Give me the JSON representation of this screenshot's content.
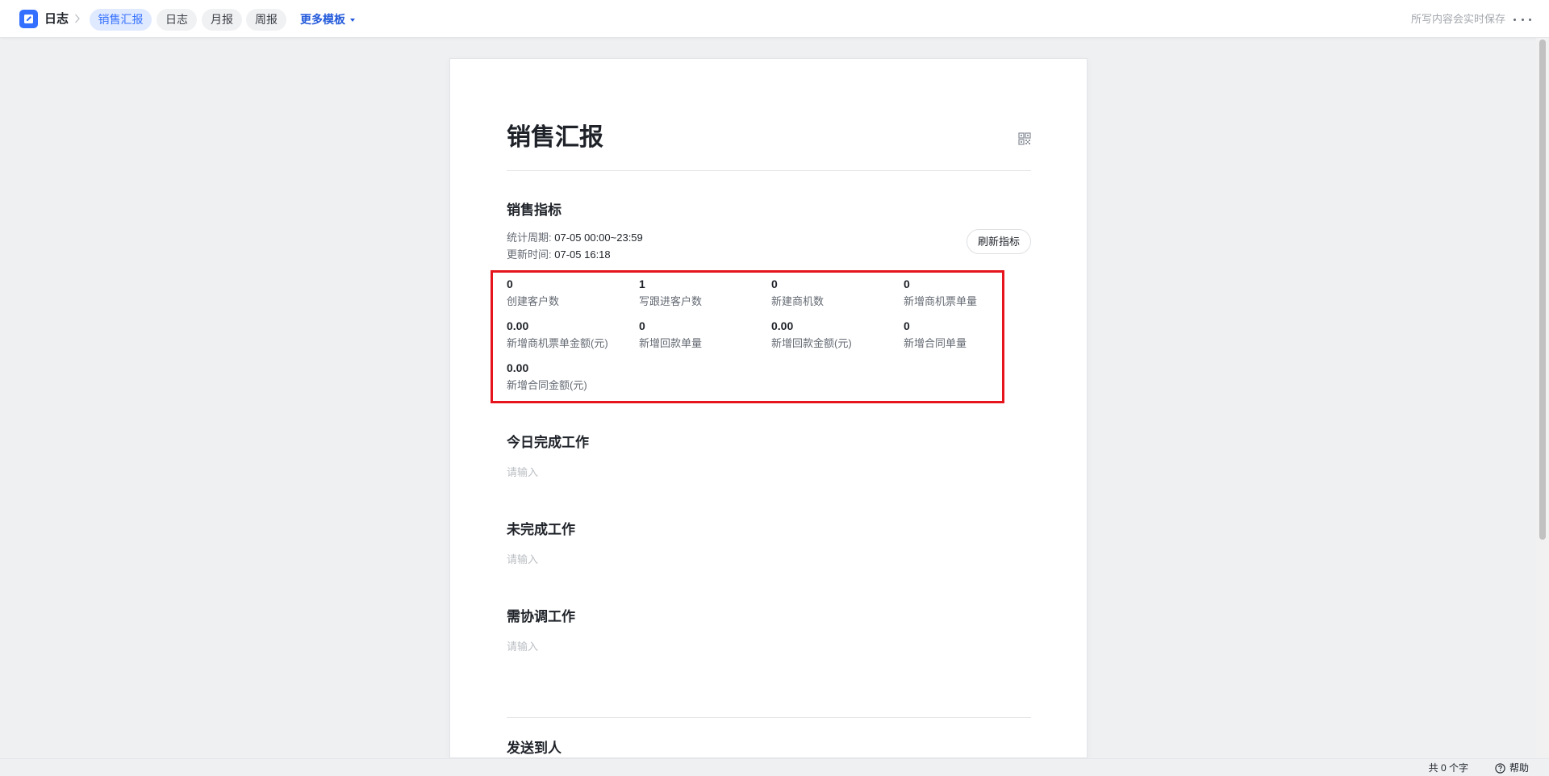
{
  "header": {
    "app_title": "日志",
    "tabs": [
      {
        "label": "销售汇报",
        "active": true
      },
      {
        "label": "日志",
        "active": false
      },
      {
        "label": "月报",
        "active": false
      },
      {
        "label": "周报",
        "active": false
      }
    ],
    "more_templates": "更多模板",
    "autosave_note": "所写内容会实时保存"
  },
  "document": {
    "title": "销售汇报",
    "metrics_section": {
      "title": "销售指标",
      "period_label": "统计周期:",
      "period_value": "07-05 00:00~23:59",
      "updated_label": "更新时间:",
      "updated_value": "07-05 16:18",
      "refresh_button": "刷新指标",
      "items": [
        {
          "value": "0",
          "label": "创建客户数"
        },
        {
          "value": "1",
          "label": "写跟进客户数"
        },
        {
          "value": "0",
          "label": "新建商机数"
        },
        {
          "value": "0",
          "label": "新增商机票单量"
        },
        {
          "value": "0.00",
          "label": "新增商机票单金额(元)"
        },
        {
          "value": "0",
          "label": "新增回款单量"
        },
        {
          "value": "0.00",
          "label": "新增回款金额(元)"
        },
        {
          "value": "0",
          "label": "新增合同单量"
        },
        {
          "value": "0.00",
          "label": "新增合同金额(元)"
        }
      ]
    },
    "sections": [
      {
        "title": "今日完成工作",
        "placeholder": "请输入"
      },
      {
        "title": "未完成工作",
        "placeholder": "请输入"
      },
      {
        "title": "需协调工作",
        "placeholder": "请输入"
      }
    ],
    "send_to_title": "发送到人"
  },
  "footer": {
    "word_count": "共 0 个字",
    "help": "帮助"
  },
  "colors": {
    "accent": "#3370ff",
    "highlight_border": "#e5141d"
  }
}
